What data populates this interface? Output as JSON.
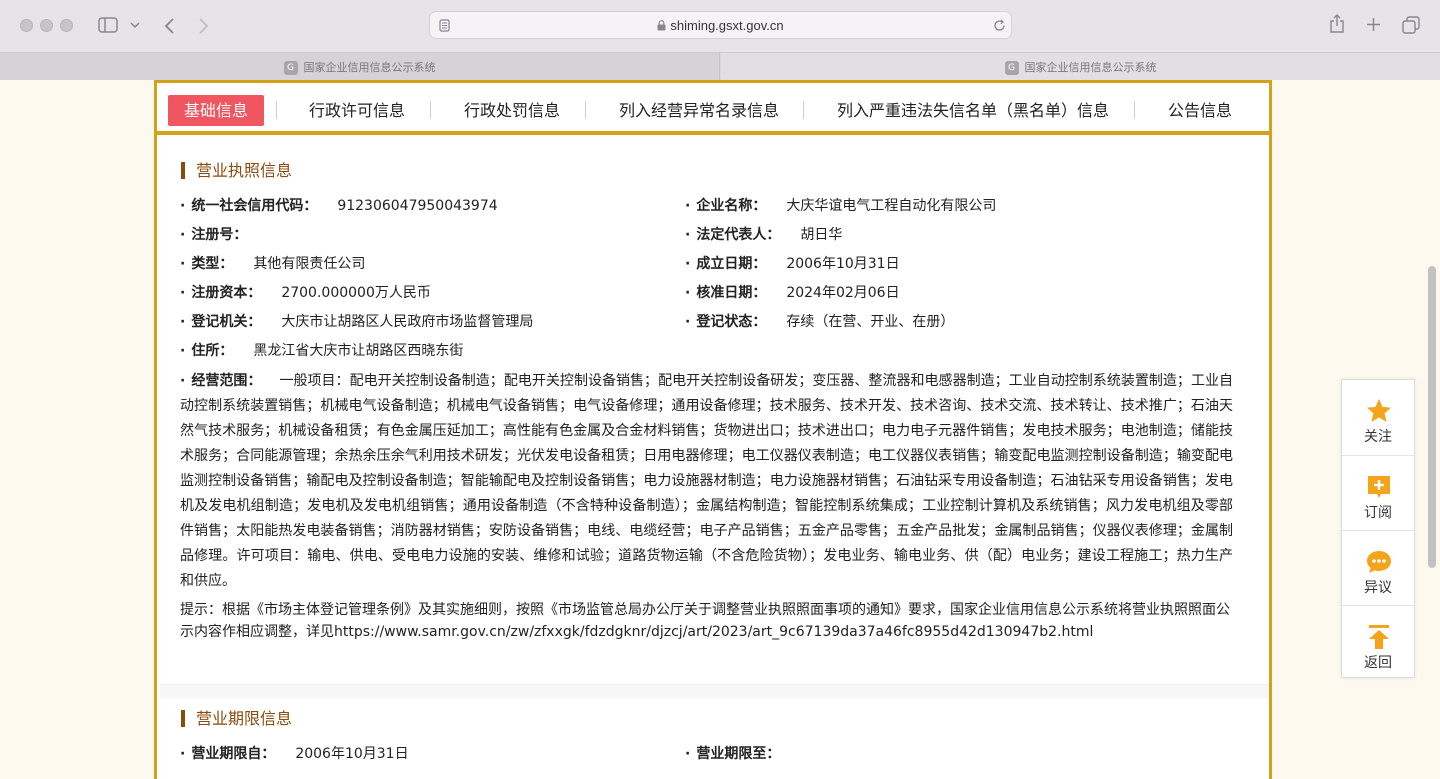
{
  "browser": {
    "url": "shiming.gsxt.gov.cn",
    "tabs": [
      {
        "title": "国家企业信用信息公示系统",
        "favicon": "G"
      },
      {
        "title": "国家企业信用信息公示系统",
        "favicon": "G"
      }
    ]
  },
  "nav": {
    "items": [
      "基础信息",
      "行政许可信息",
      "行政处罚信息",
      "列入经营异常名录信息",
      "列入严重违法失信名单（黑名单）信息",
      "公告信息"
    ],
    "active_index": 0,
    "active_color": "#f05660",
    "frame_color": "#d3a218"
  },
  "license": {
    "title": "营业执照信息",
    "fields": {
      "credit_code": {
        "label": "统一社会信用代码：",
        "value": "912306047950043974"
      },
      "company_name": {
        "label": "企业名称：",
        "value": "大庆华谊电气工程自动化有限公司"
      },
      "reg_no": {
        "label": "注册号：",
        "value": ""
      },
      "legal_rep": {
        "label": "法定代表人：",
        "value": "胡日华"
      },
      "type": {
        "label": "类型：",
        "value": "其他有限责任公司"
      },
      "established": {
        "label": "成立日期：",
        "value": "2006年10月31日"
      },
      "capital": {
        "label": "注册资本：",
        "value": "2700.000000万人民币"
      },
      "approved": {
        "label": "核准日期：",
        "value": "2024年02月06日"
      },
      "authority": {
        "label": "登记机关：",
        "value": "大庆市让胡路区人民政府市场监督管理局"
      },
      "status": {
        "label": "登记状态：",
        "value": "存续（在营、开业、在册）"
      },
      "address": {
        "label": "住所：",
        "value": "黑龙江省大庆市让胡路区西晓东街"
      }
    },
    "scope_label": "经营范围：",
    "scope_value": "一般项目：配电开关控制设备制造；配电开关控制设备销售；配电开关控制设备研发；变压器、整流器和电感器制造；工业自动控制系统装置制造；工业自动控制系统装置销售；机械电气设备制造；机械电气设备销售；电气设备修理；通用设备修理；技术服务、技术开发、技术咨询、技术交流、技术转让、技术推广；石油天然气技术服务；机械设备租赁；有色金属压延加工；高性能有色金属及合金材料销售；货物进出口；技术进出口；电力电子元器件销售；发电技术服务；电池制造；储能技术服务；合同能源管理；余热余压余气利用技术研发；光伏发电设备租赁；日用电器修理；电工仪器仪表制造；电工仪器仪表销售；输变配电监测控制设备制造；输变配电监测控制设备销售；输配电及控制设备制造；智能输配电及控制设备销售；电力设施器材制造；电力设施器材销售；石油钻采专用设备制造；石油钻采专用设备销售；发电机及发电机组制造；发电机及发电机组销售；通用设备制造（不含特种设备制造）；金属结构制造；智能控制系统集成；工业控制计算机及系统销售；风力发电机组及零部件销售；太阳能热发电装备销售；消防器材销售；安防设备销售；电线、电缆经营；电子产品销售；五金产品零售；五金产品批发；金属制品销售；仪器仪表修理；金属制品修理。许可项目：输电、供电、受电电力设施的安装、维修和试验；道路货物运输（不含危险货物）；发电业务、输电业务、供（配）电业务；建设工程施工；热力生产和供应。",
    "hint": "提示：根据《市场主体登记管理条例》及其实施细则，按照《市场监管总局办公厅关于调整营业执照照面事项的通知》要求，国家企业信用信息公示系统将营业执照照面公示内容作相应调整，详见https://www.samr.gov.cn/zw/zfxxgk/fdzdgknr/djzcj/art/2023/art_9c67139da37a46fc8955d42d130947b2.html"
  },
  "term": {
    "title": "营业期限信息",
    "from": {
      "label": "营业期限自：",
      "value": "2006年10月31日"
    },
    "to": {
      "label": "营业期限至：",
      "value": ""
    }
  },
  "side_tools": [
    {
      "label": "关注",
      "icon": "star-icon"
    },
    {
      "label": "订阅",
      "icon": "subscribe-plus-icon"
    },
    {
      "label": "异议",
      "icon": "chat-bubble-icon"
    },
    {
      "label": "返回",
      "icon": "arrow-up-icon"
    }
  ]
}
